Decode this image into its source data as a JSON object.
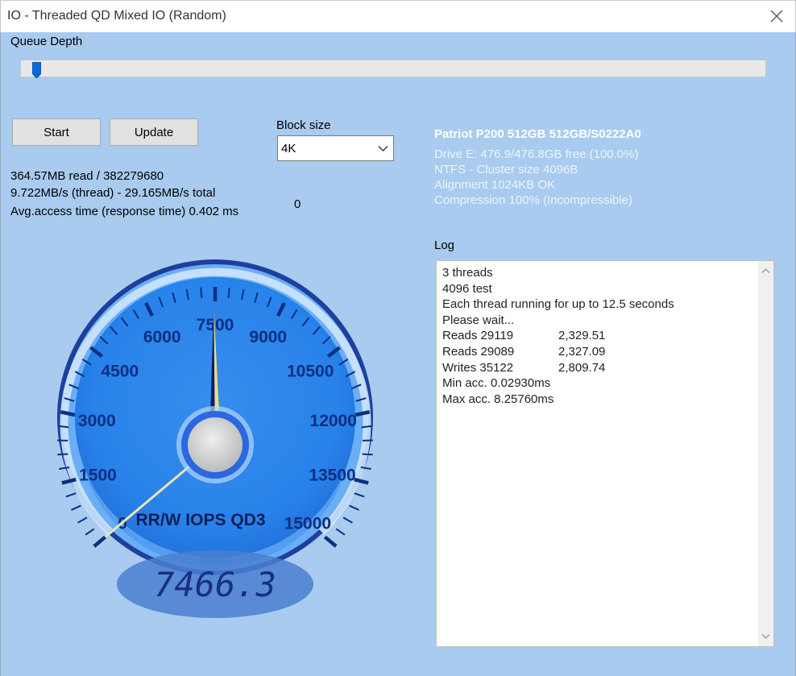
{
  "window": {
    "title": "IO - Threaded QD Mixed IO (Random)"
  },
  "queue_depth": {
    "label": "Queue Depth",
    "slider_position_fraction": 0.022
  },
  "buttons": {
    "start": "Start",
    "update": "Update"
  },
  "block_size": {
    "label": "Block size",
    "value": "4K"
  },
  "stats": {
    "line1": "364.57MB read / 382279680",
    "line2": "9.722MB/s (thread) - 29.165MB/s total",
    "line3": "Avg.access time (response time) 0.402 ms",
    "counter": "0"
  },
  "drive": {
    "title": "Patriot P200 512GB 512GB/S0222A0",
    "line1": "Drive E: 476.9/476.8GB free (100.0%)",
    "line2": "NTFS - Cluster size 4096B",
    "line3": "Alignment 1024KB OK",
    "line4": "Compression 100% (Incompressible)"
  },
  "log": {
    "label": "Log",
    "entries": [
      [
        "3 threads",
        ""
      ],
      [
        "4096 test",
        ""
      ],
      [
        "Each thread running for up to 12.5 seconds",
        ""
      ],
      [
        "Please wait...",
        ""
      ],
      [
        "Reads 29119",
        "2,329.51"
      ],
      [
        "Reads 29089",
        "2,327.09"
      ],
      [
        "Writes 35122",
        "2,809.74"
      ],
      [
        "Min acc. 0.02930ms",
        ""
      ],
      [
        "Max acc. 8.25760ms",
        ""
      ]
    ]
  },
  "gauge": {
    "label": "RR/W IOPS QD3",
    "min": 0,
    "max": 15000,
    "ticks": [
      "0",
      "1500",
      "3000",
      "4500",
      "6000",
      "7500",
      "9000",
      "10500",
      "12000",
      "13500",
      "15000"
    ],
    "value": 7466.3,
    "display": "7466.3",
    "colors": {
      "face": "#2f8bf0",
      "needle": "#101a66",
      "needle_highlight": "#e4e08a",
      "ring": "#1d3f9e",
      "display": "#4a7fd0"
    }
  },
  "icons": {
    "close": "close-icon",
    "dropdown": "chevron-down-icon",
    "scroll_up": "scroll-up-arrow-icon",
    "scroll_down": "scroll-down-arrow-icon"
  }
}
